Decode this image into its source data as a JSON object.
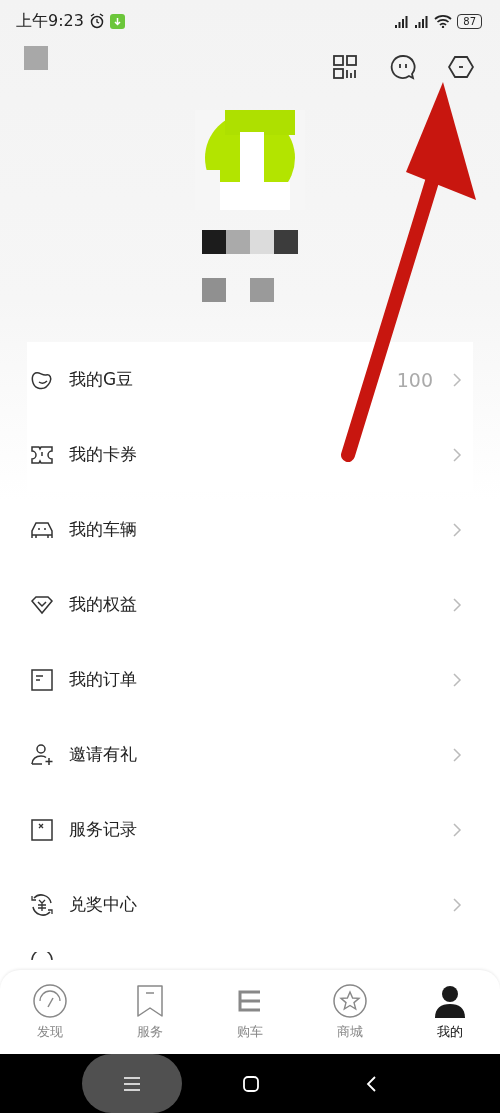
{
  "status_bar": {
    "time": "上午9:23",
    "battery": "87"
  },
  "header": {
    "actions": [
      {
        "kind": "scan"
      },
      {
        "kind": "chat"
      },
      {
        "kind": "settings"
      }
    ]
  },
  "menu": [
    {
      "label": "我的G豆",
      "value": "100",
      "kind": "bean"
    },
    {
      "label": "我的卡券",
      "kind": "ticket"
    },
    {
      "label": "我的车辆",
      "kind": "car"
    },
    {
      "label": "我的权益",
      "kind": "diamond"
    },
    {
      "label": "我的订单",
      "kind": "order"
    },
    {
      "label": "邀请有礼",
      "kind": "invite"
    },
    {
      "label": "服务记录",
      "kind": "record"
    },
    {
      "label": "兑奖中心",
      "kind": "exchange"
    }
  ],
  "tab_bar": [
    {
      "label": "发现",
      "kind": "gauge",
      "selected": false
    },
    {
      "label": "服务",
      "kind": "bookmark",
      "selected": false
    },
    {
      "label": "购车",
      "kind": "e",
      "selected": false
    },
    {
      "label": "商城",
      "kind": "star",
      "selected": false
    },
    {
      "label": "我的",
      "kind": "person",
      "selected": true
    }
  ],
  "annotation": {
    "kind": "arrow"
  }
}
